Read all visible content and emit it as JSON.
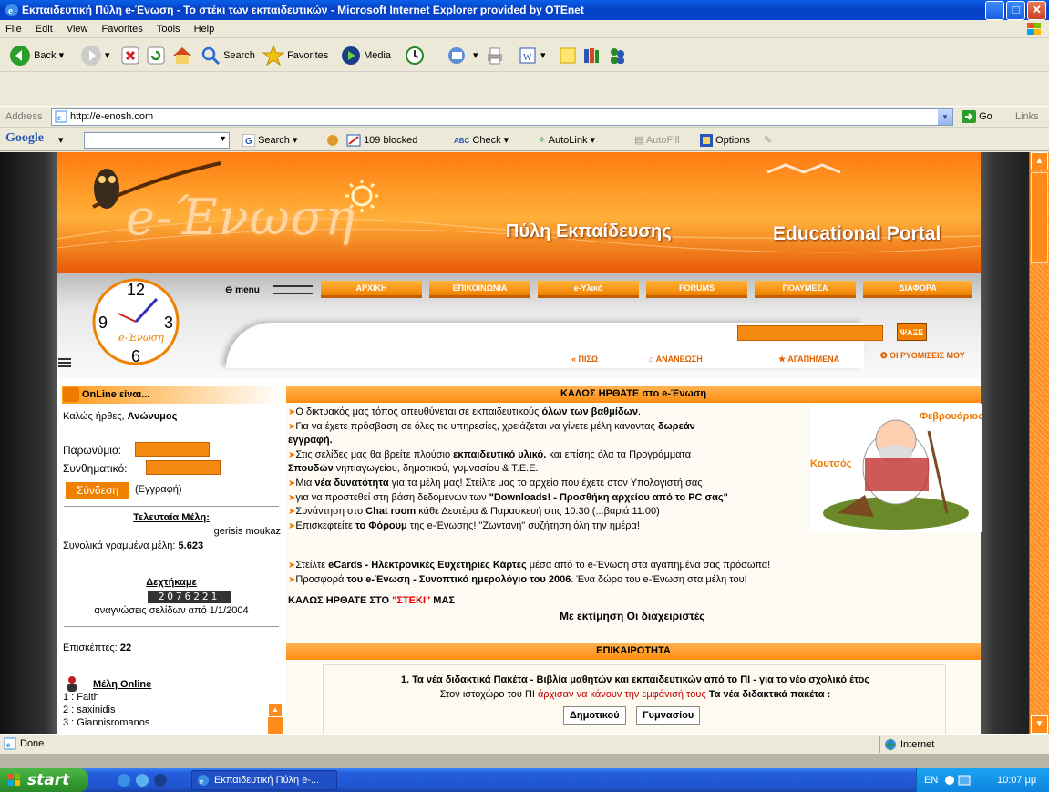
{
  "window": {
    "title": "Εκπαιδευτική Πύλη e-Ένωση - Το στέκι των εκπαιδευτικών - Microsoft Internet Explorer provided by OTEnet"
  },
  "menubar": [
    "File",
    "Edit",
    "View",
    "Favorites",
    "Tools",
    "Help"
  ],
  "toolbar": {
    "back": "Back",
    "search": "Search",
    "favorites": "Favorites",
    "media": "Media"
  },
  "address": {
    "label": "Address",
    "url": "http://e-enosh.com",
    "go": "Go",
    "links": "Links"
  },
  "googlebar": {
    "logo": "Google",
    "search": "Search",
    "blocked": "109 blocked",
    "check": "Check",
    "autolink": "AutoLink",
    "autofill": "AutoFill",
    "options": "Options"
  },
  "site": {
    "banner_logo": "e-Ένωση",
    "banner_gr": "Πύλη Εκπαίδευσης",
    "banner_en": "Educational Portal",
    "menu_label": "menu",
    "nav": [
      "ΑΡΧΙΚΗ",
      "ΕΠΙΚΟΙΝΩΝΙΑ",
      "e-Υλικό",
      "FORUMS",
      "ΠΟΛΥΜΕΣΑ",
      "ΔΙΑΦΟΡΑ"
    ],
    "search_button": "ΨΑΞΕ",
    "subnav": [
      "ΠΙΣΩ",
      "ΑΝΑΝΕΩΣΗ",
      "ΑΓΑΠΗΜΕΝΑ",
      "ΟΙ ΡΥΘΜΙΣΕΙΣ ΜΟΥ"
    ]
  },
  "left": {
    "header": "OnLine είναι...",
    "greeting_prefix": "Καλώς ήρθες,",
    "greeting_user": "Ανώνυμος",
    "nick_label": "Παρωνύμιο:",
    "pass_label": "Συνθηματικό:",
    "login": "Σύνδεση",
    "register": "(Εγγραφή)",
    "last_members_title": "Τελευταία Μέλη:",
    "last_members": "gerisis moukaz",
    "total_prefix": "Συνολικά γραμμένα μέλη:",
    "total_value": "5.623",
    "hits_title": "Δεχτήκαμε",
    "hits_value": "2076221",
    "hits_caption": "αναγνώσεις σελίδων από 1/1/2004",
    "visitors_label": "Επισκέπτες:",
    "visitors_value": "22",
    "online_title": "Μέλη Online",
    "online_members": [
      "1 : Faith",
      "2 : saxinidis",
      "3 : Giannisromanos"
    ]
  },
  "main": {
    "welcome_header": "ΚΑΛΩΣ ΗΡΘΑΤΕ στο e-Ένωση",
    "lines": [
      [
        "Ο δικτυακός μας τόπος απευθύνεται σε εκπαιδευτικούς ",
        "όλων των βαθμίδων",
        "."
      ],
      [
        "Για να έχετε πρόσβαση σε όλες τις υπηρεσίες, χρειάζεται να γίνετε μέλη κάνοντας ",
        "δωρεάν",
        ""
      ],
      [
        "",
        "εγγραφή.",
        ""
      ],
      [
        "Στις σελίδες μας θα βρείτε πλούσιο ",
        "εκπαιδευτικό υλικό.",
        " και επίσης όλα τα Προγράμματα"
      ],
      [
        "",
        "Σπουδών",
        " νηπιαγωγείου, δημοτικού, γυμνασίου & Τ.Ε.Ε."
      ],
      [
        "Μια ",
        "νέα δυνατότητα",
        " για τα μέλη μας! Στείλτε μας το αρχείο που έχετε στον Υπολογιστή σας"
      ],
      [
        "για να προστεθεί στη βάση δεδομένων των ",
        "\"Downloads! - Προσθήκη αρχείου από το PC σας\"",
        ""
      ],
      [
        "Συνάντηση στο ",
        "Chat room",
        " κάθε Δευτέρα & Παρασκευή στις 10.30 (...βαριά 11.00)"
      ],
      [
        "Επισκεφτείτε ",
        "το Φόρουμ",
        " της e-Ένωσης! \"Ζωντανή\" συζήτηση όλη την ημέρα!"
      ]
    ],
    "tail_lines": [
      [
        "Στείλτε ",
        "eCards - Ηλεκτρονικές Ευχετήριες Κάρτες",
        " μέσα από το e-Ένωση στα αγαπημένα σας πρόσωπα!"
      ],
      [
        "Προσφορά ",
        "του e-Ένωση - Συνοπτικό ημερολόγιο του 2006",
        ". Ένα δώρο του e-Ένωση στα μέλη του!"
      ]
    ],
    "cartoon_label1": "Φεβρουάριος",
    "cartoon_label2": "Κουτσός",
    "kalos_prefix": "ΚΑΛΩΣ ΗΡΘΑΤΕ ΣΤΟ ",
    "kalos_red": "\"ΣΤΕΚΙ\"",
    "kalos_suffix": " ΜΑΣ",
    "signoff": "Με εκτίμηση Οι διαχειριστές",
    "news_header": "ΕΠΙΚΑΙΡΟΤΗΤΑ",
    "news_title": "1. Τα νέα διδακτικά Πακέτα - Βιβλία μαθητών και εκπαιδευτικών από το ΠΙ - για το νέο σχολικό έτος",
    "news_sub_prefix": "Στον ιστοχώρο του ΠΙ ",
    "news_sub_red": "άρχισαν να κάνουν την εμφάνισή τους",
    "news_sub_bold": " Τα νέα διδακτικά πακέτα :",
    "news_buttons": [
      "Δημοτικού",
      "Γυμνασίου"
    ]
  },
  "status": {
    "text": "Done",
    "zone": "Internet"
  },
  "taskbar": {
    "start": "start",
    "item": "Εκπαιδευτική Πύλη e-...",
    "lang": "EN",
    "clock": "10:07 μμ"
  }
}
